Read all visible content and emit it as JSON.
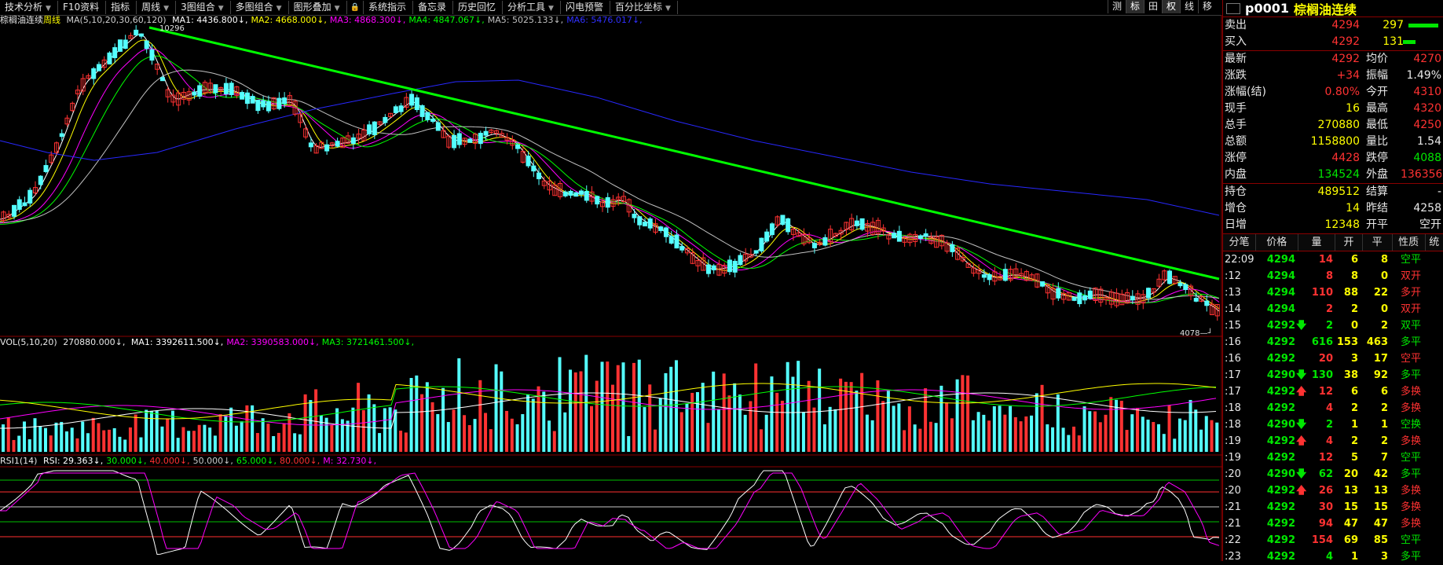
{
  "toolbar": {
    "items": [
      {
        "label": "技术分析",
        "dropdown": true
      },
      {
        "label": "F10资料",
        "dropdown": false
      },
      {
        "label": "指标",
        "dropdown": false
      },
      {
        "label": "周线",
        "dropdown": true
      },
      {
        "label": "3图组合",
        "dropdown": true
      },
      {
        "label": "多图组合",
        "dropdown": true
      },
      {
        "label": "图形叠加",
        "dropdown": true
      },
      {
        "label": "系统指示",
        "dropdown": false
      },
      {
        "label": "备忘录",
        "dropdown": false
      },
      {
        "label": "历史回忆",
        "dropdown": false
      },
      {
        "label": "分析工具",
        "dropdown": true
      },
      {
        "label": "闪电预警",
        "dropdown": false
      },
      {
        "label": "百分比坐标",
        "dropdown": true
      }
    ],
    "right_buttons": [
      "测",
      "标",
      "田",
      "权",
      "线",
      "移"
    ],
    "active_right": [
      "标",
      "权"
    ],
    "lock_icon": "lock-icon"
  },
  "main_chart": {
    "title_name": "棕榈油连续",
    "period": "周线",
    "ma_label": "MA(5,10,20,30,60,120)",
    "ma_values": [
      {
        "name": "MA1",
        "value": "4436.800",
        "color": "#ffffff"
      },
      {
        "name": "MA2",
        "value": "4668.000",
        "color": "#ffff00"
      },
      {
        "name": "MA3",
        "value": "4868.300",
        "color": "#ff00ff"
      },
      {
        "name": "MA4",
        "value": "4847.067",
        "color": "#00ff00"
      },
      {
        "name": "MA5",
        "value": "5025.133",
        "color": "#c0c0c0"
      },
      {
        "name": "MA6",
        "value": "5476.017",
        "color": "#3030ff"
      }
    ],
    "high_label": "10296",
    "low_label": "4078",
    "trendline_color": "#00ff00"
  },
  "volume": {
    "label": "VOL(5,10,20)",
    "value": "270880.000",
    "ma_values": [
      {
        "name": "MA1",
        "value": "3392611.500",
        "color": "#ffffff"
      },
      {
        "name": "MA2",
        "value": "3390583.000",
        "color": "#ff00ff"
      },
      {
        "name": "MA3",
        "value": "3721461.500",
        "color": "#00ff00"
      }
    ]
  },
  "rsi": {
    "label": "RSI1(14)",
    "values": [
      {
        "name": "RSI",
        "value": "29.363",
        "color": "#ffffff"
      },
      {
        "name": "",
        "value": "30.000",
        "color": "#00ff00"
      },
      {
        "name": "",
        "value": "40.000",
        "color": "#ff3030"
      },
      {
        "name": "",
        "value": "50.000",
        "color": "#c8c8c8"
      },
      {
        "name": "",
        "value": "65.000",
        "color": "#00ff00"
      },
      {
        "name": "",
        "value": "80.000",
        "color": "#ff3030"
      },
      {
        "name": "M",
        "value": "32.730",
        "color": "#ff00ff"
      }
    ]
  },
  "panel": {
    "code": "p0001",
    "name": "棕榈油连续",
    "sell": {
      "label": "卖出",
      "price": "4294",
      "vol": "297",
      "side": "+"
    },
    "buy": {
      "label": "买入",
      "price": "4292",
      "vol": "131",
      "side": "+"
    },
    "quotes": [
      {
        "l1": "最新",
        "v1": "4292",
        "c1": "red",
        "l2": "均价",
        "v2": "4270",
        "c2": "red"
      },
      {
        "l1": "涨跌",
        "v1": "+34",
        "c1": "red",
        "l2": "振幅",
        "v2": "1.49%",
        "c2": "white"
      },
      {
        "l1": "涨幅(结)",
        "v1": "0.80%",
        "c1": "red",
        "l2": "今开",
        "v2": "4310",
        "c2": "red"
      },
      {
        "l1": "现手",
        "v1": "16",
        "c1": "yellow",
        "l2": "最高",
        "v2": "4320",
        "c2": "red"
      },
      {
        "l1": "总手",
        "v1": "270880",
        "c1": "yellow",
        "l2": "最低",
        "v2": "4250",
        "c2": "red"
      },
      {
        "l1": "总额",
        "v1": "1158800",
        "c1": "yellow",
        "l2": "量比",
        "v2": "1.54",
        "c2": "white"
      },
      {
        "l1": "涨停",
        "v1": "4428",
        "c1": "red",
        "l2": "跌停",
        "v2": "4088",
        "c2": "green"
      },
      {
        "l1": "内盘",
        "v1": "134524",
        "c1": "green",
        "l2": "外盘",
        "v2": "136356",
        "c2": "red"
      }
    ],
    "quotes2": [
      {
        "l1": "持仓",
        "v1": "489512",
        "c1": "yellow",
        "l2": "结算",
        "v2": "-",
        "c2": "white"
      },
      {
        "l1": "增仓",
        "v1": "14",
        "c1": "yellow",
        "l2": "昨结",
        "v2": "4258",
        "c2": "white"
      },
      {
        "l1": "日增",
        "v1": "12348",
        "c1": "yellow",
        "l2": "开平",
        "v2": "空开",
        "c2": "white"
      }
    ],
    "tick_headers": [
      "分笔",
      "价格",
      "量",
      "开",
      "平",
      "性质",
      "统"
    ],
    "ticks": [
      {
        "time": "22:09",
        "price": "4294",
        "arrow": "",
        "vol": "14",
        "open": "6",
        "close": "8",
        "nature": "空平",
        "nc": "green",
        "vc": "red"
      },
      {
        "time": ":12",
        "price": "4294",
        "arrow": "",
        "vol": "8",
        "open": "8",
        "close": "0",
        "nature": "双开",
        "nc": "red",
        "vc": "red"
      },
      {
        "time": ":13",
        "price": "4294",
        "arrow": "",
        "vol": "110",
        "open": "88",
        "close": "22",
        "nature": "多开",
        "nc": "red",
        "vc": "red"
      },
      {
        "time": ":14",
        "price": "4294",
        "arrow": "",
        "vol": "2",
        "open": "2",
        "close": "0",
        "nature": "双开",
        "nc": "red",
        "vc": "red"
      },
      {
        "time": ":15",
        "price": "4292",
        "arrow": "down",
        "vol": "2",
        "open": "0",
        "close": "2",
        "nature": "双平",
        "nc": "green",
        "vc": "green"
      },
      {
        "time": ":16",
        "price": "4292",
        "arrow": "",
        "vol": "616",
        "open": "153",
        "close": "463",
        "nature": "多平",
        "nc": "green",
        "vc": "green"
      },
      {
        "time": ":16",
        "price": "4292",
        "arrow": "",
        "vol": "20",
        "open": "3",
        "close": "17",
        "nature": "空平",
        "nc": "red",
        "vc": "red"
      },
      {
        "time": ":17",
        "price": "4290",
        "arrow": "down",
        "vol": "130",
        "open": "38",
        "close": "92",
        "nature": "多平",
        "nc": "green",
        "vc": "green"
      },
      {
        "time": ":17",
        "price": "4292",
        "arrow": "up",
        "vol": "12",
        "open": "6",
        "close": "6",
        "nature": "多换",
        "nc": "red",
        "vc": "red"
      },
      {
        "time": ":18",
        "price": "4292",
        "arrow": "",
        "vol": "4",
        "open": "2",
        "close": "2",
        "nature": "多换",
        "nc": "red",
        "vc": "red"
      },
      {
        "time": ":18",
        "price": "4290",
        "arrow": "down",
        "vol": "2",
        "open": "1",
        "close": "1",
        "nature": "空换",
        "nc": "green",
        "vc": "green"
      },
      {
        "time": ":19",
        "price": "4292",
        "arrow": "up",
        "vol": "4",
        "open": "2",
        "close": "2",
        "nature": "多换",
        "nc": "red",
        "vc": "red"
      },
      {
        "time": ":19",
        "price": "4292",
        "arrow": "",
        "vol": "12",
        "open": "5",
        "close": "7",
        "nature": "空平",
        "nc": "green",
        "vc": "red"
      },
      {
        "time": ":20",
        "price": "4290",
        "arrow": "down",
        "vol": "62",
        "open": "20",
        "close": "42",
        "nature": "多平",
        "nc": "green",
        "vc": "green"
      },
      {
        "time": ":20",
        "price": "4292",
        "arrow": "up",
        "vol": "26",
        "open": "13",
        "close": "13",
        "nature": "多换",
        "nc": "red",
        "vc": "red"
      },
      {
        "time": ":21",
        "price": "4292",
        "arrow": "",
        "vol": "30",
        "open": "15",
        "close": "15",
        "nature": "多换",
        "nc": "red",
        "vc": "red"
      },
      {
        "time": ":21",
        "price": "4292",
        "arrow": "",
        "vol": "94",
        "open": "47",
        "close": "47",
        "nature": "多换",
        "nc": "red",
        "vc": "red"
      },
      {
        "time": ":22",
        "price": "4292",
        "arrow": "",
        "vol": "154",
        "open": "69",
        "close": "85",
        "nature": "空平",
        "nc": "green",
        "vc": "red"
      },
      {
        "time": ":23",
        "price": "4292",
        "arrow": "",
        "vol": "4",
        "open": "1",
        "close": "3",
        "nature": "多平",
        "nc": "green",
        "vc": "green"
      }
    ]
  },
  "colors": {
    "up": "#ff3232",
    "down": "#54ffff",
    "border": "#8a0000",
    "trendline": "#00ff00"
  }
}
